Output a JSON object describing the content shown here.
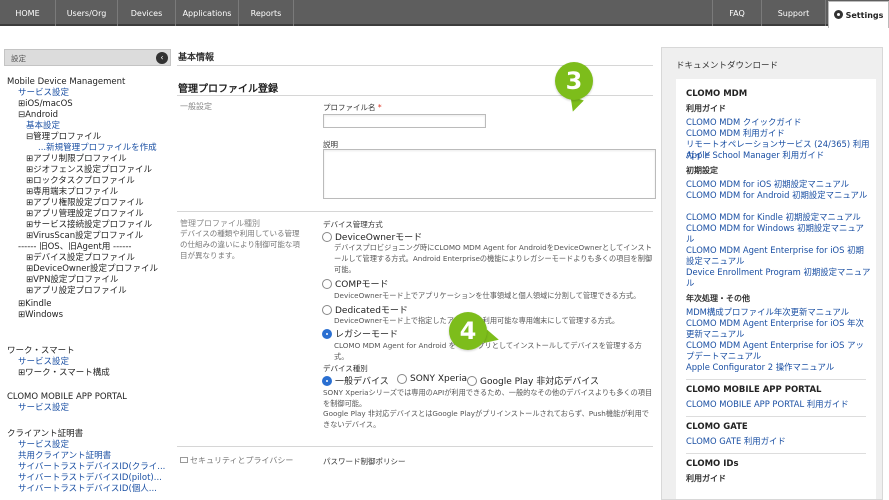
{
  "nav": {
    "home": "HOME",
    "users_org": "Users/Org",
    "devices": "Devices",
    "applications": "Applications",
    "reports": "Reports",
    "faq": "FAQ",
    "support": "Support",
    "settings": "Settings"
  },
  "sidebar": {
    "header": "設定",
    "items": [
      {
        "label": "Mobile Device Management",
        "kind": "plain"
      },
      {
        "label": "サービス設定",
        "kind": "link"
      },
      {
        "label": "⊞iOS/macOS",
        "kind": "plain"
      },
      {
        "label": "⊟Android",
        "kind": "plain"
      },
      {
        "label": "基本設定",
        "kind": "link"
      },
      {
        "label": "⊟管理プロファイル",
        "kind": "plain"
      },
      {
        "label": "...新規管理プロファイルを作成",
        "kind": "link"
      },
      {
        "label": "⊞アプリ制限プロファイル",
        "kind": "plain"
      },
      {
        "label": "⊞ジオフェンス設定プロファイル",
        "kind": "plain"
      },
      {
        "label": "⊞ロックタスクプロファイル",
        "kind": "plain"
      },
      {
        "label": "⊞専用端末プロファイル",
        "kind": "plain"
      },
      {
        "label": "⊞アプリ権限設定プロファイル",
        "kind": "plain"
      },
      {
        "label": "⊞アプリ管理設定プロファイル",
        "kind": "plain"
      },
      {
        "label": "⊞サービス接続設定プロファイル",
        "kind": "plain"
      },
      {
        "label": "⊞VirusScan設定プロファイル",
        "kind": "plain"
      },
      {
        "label": "------ 旧OS、旧Agent用 ------",
        "kind": "plain"
      },
      {
        "label": "⊞デバイス設定プロファイル",
        "kind": "plain"
      },
      {
        "label": "⊞DeviceOwner設定プロファイル",
        "kind": "plain"
      },
      {
        "label": "⊞VPN設定プロファイル",
        "kind": "plain"
      },
      {
        "label": "⊞アプリ設定プロファイル",
        "kind": "plain"
      },
      {
        "label": "⊞Kindle",
        "kind": "plain"
      },
      {
        "label": "⊞Windows",
        "kind": "plain"
      },
      {
        "label": "ワーク・スマート",
        "kind": "plain"
      },
      {
        "label": "サービス設定",
        "kind": "link"
      },
      {
        "label": "⊞ワーク・スマート構成",
        "kind": "plain"
      },
      {
        "label": "CLOMO MOBILE APP PORTAL",
        "kind": "plain"
      },
      {
        "label": "サービス設定",
        "kind": "link"
      },
      {
        "label": "クライアント証明書",
        "kind": "plain"
      },
      {
        "label": "サービス設定",
        "kind": "link"
      },
      {
        "label": "共用クライアント証明書",
        "kind": "link"
      },
      {
        "label": "サイバートラストデバイスID(クライ...",
        "kind": "link"
      },
      {
        "label": "サイバートラストデバイスID(pilot)...",
        "kind": "link"
      },
      {
        "label": "サイバートラストデバイスID(個人...",
        "kind": "link"
      }
    ]
  },
  "main": {
    "section_title": "基本情報",
    "form_title": "管理プロファイル登録",
    "general_label": "一般設定",
    "profile_name_label": "プロファイル名",
    "required_mark": "*",
    "profile_name_value": "",
    "description_label": "説明",
    "description_value": "",
    "type_label": "管理プロファイル種別",
    "type_desc": "デバイスの種類や利用している管理の仕組みの違いにより制御可能な項目が異なります。",
    "mgmt_method_label": "デバイス管理方式",
    "modes": [
      {
        "label": "DeviceOwnerモード",
        "selected": false,
        "desc": "デバイスプロビジョニング時にCLOMO MDM Agent for AndroidをDeviceOwnerとしてインストールして管理する方式。Android Enterpriseの機能によりレガシーモードよりも多くの項目を制御可能。"
      },
      {
        "label": "COMPモード",
        "selected": false,
        "desc": "DeviceOwnerモード上でアプリケーションを仕事領域と個人領域に分割して管理できる方式。"
      },
      {
        "label": "Dedicatedモード",
        "selected": false,
        "desc": "DeviceOwnerモード上で指定したアプリだけ利用可能な専用端末にして管理する方式。"
      },
      {
        "label": "レガシーモード",
        "selected": true,
        "desc": "CLOMO MDM Agent for Android を一般アプリとしてインストールしてデバイスを管理する方式。"
      }
    ],
    "device_type_label": "デバイス種別",
    "device_types": [
      {
        "label": "一般デバイス",
        "selected": true
      },
      {
        "label": "SONY Xperia",
        "selected": false
      },
      {
        "label": "Google Play 非対応デバイス",
        "selected": false
      }
    ],
    "device_type_desc1": "SONY Xperiaシリーズでは専用のAPIが利用できるため、一般的なその他のデバイスよりも多くの項目を制御可能。",
    "device_type_desc2": "Google Play 非対応デバイスとはGoogle Playがプリインストールされておらず、Push機能が利用できないデバイス。",
    "security_label": "セキュリティとプライバシー",
    "password_policy_label": "パスワード制御ポリシー",
    "badge3": "3",
    "badge4": "4",
    "badge_color": "#7dbd1b"
  },
  "right": {
    "title": "ドキュメントダウンロード",
    "sections": [
      {
        "title": "CLOMO MDM",
        "groups": [
          {
            "title": "利用ガイド",
            "links": [
              "CLOMO MDM クイックガイド",
              "CLOMO MDM 利用ガイド",
              "リモートオペレーションサービス (24/365) 利用ガイド",
              "Apple School Manager 利用ガイド"
            ]
          },
          {
            "title": "初期設定",
            "links": [
              "CLOMO MDM for iOS 初期設定マニュアル",
              "CLOMO MDM for Android 初期設定マニュアル",
              "CLOMO MDM for Kindle 初期設定マニュアル",
              "CLOMO MDM for Windows 初期設定マニュアル",
              "CLOMO MDM Agent Enterprise for iOS 初期設定マニュアル",
              "Device Enrollment Program 初期設定マニュアル"
            ]
          },
          {
            "title": "年次処理・その他",
            "links": [
              "MDM構成プロファイル年次更新マニュアル",
              "CLOMO MDM Agent Enterprise for iOS 年次更新マニュアル",
              "CLOMO MDM Agent Enterprise for iOS アップデートマニュアル",
              "Apple Configurator 2 操作マニュアル"
            ]
          }
        ]
      },
      {
        "title": "CLOMO MOBILE APP PORTAL",
        "groups": [
          {
            "title": "",
            "links": [
              "CLOMO MOBILE APP PORTAL 利用ガイド"
            ]
          }
        ]
      },
      {
        "title": "CLOMO GATE",
        "groups": [
          {
            "title": "",
            "links": [
              "CLOMO GATE 利用ガイド"
            ]
          }
        ]
      },
      {
        "title": "CLOMO IDs",
        "groups": [
          {
            "title": "利用ガイド",
            "links": []
          }
        ]
      }
    ]
  }
}
